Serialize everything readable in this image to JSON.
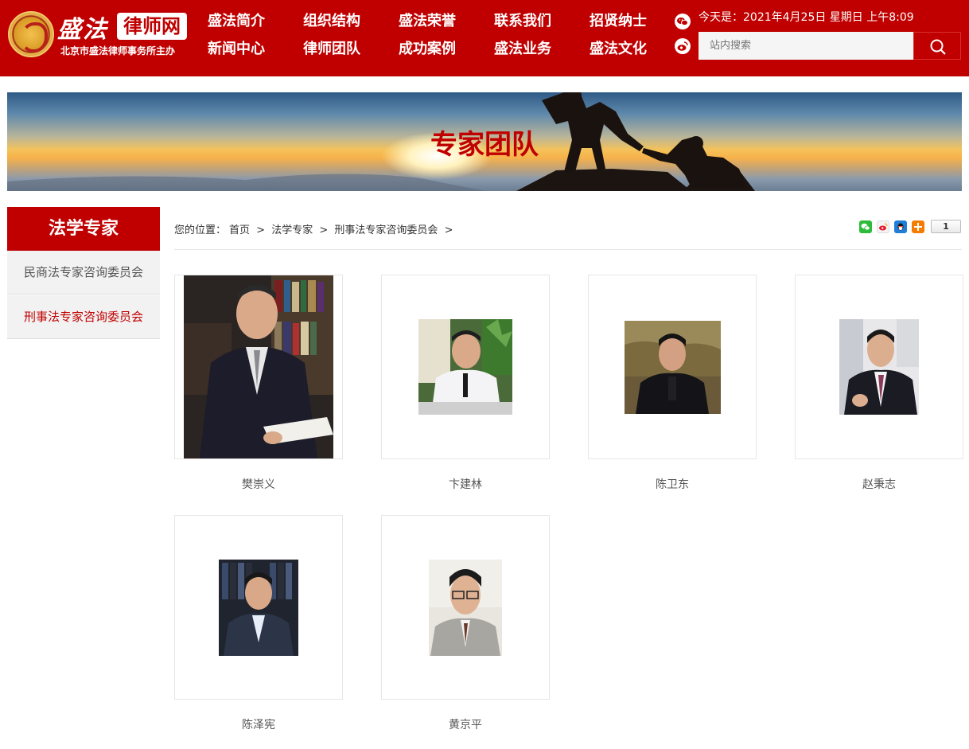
{
  "header": {
    "logo_script": "盛法",
    "logo_badge": "律师网",
    "logo_sub": "北京市盛法律师事务所主办",
    "nav_row1": [
      "盛法简介",
      "组织结构",
      "盛法荣誉",
      "联系我们",
      "招贤纳士"
    ],
    "nav_row2": [
      "新闻中心",
      "律师团队",
      "成功案例",
      "盛法业务",
      "盛法文化"
    ],
    "date_text": "今天是：2021年4月25日 星期日 上午8:09",
    "search_placeholder": "站内搜索",
    "icons": [
      "wechat-icon",
      "weibo-icon",
      "search-icon"
    ]
  },
  "banner": {
    "title": "专家团队"
  },
  "sidebar": {
    "title": "法学专家",
    "items": [
      {
        "label": "民商法专家咨询委员会",
        "active": false
      },
      {
        "label": "刑事法专家咨询委员会",
        "active": true
      }
    ]
  },
  "breadcrumb": {
    "prefix": "您的位置：",
    "items": [
      "首页",
      ">",
      "法学专家",
      ">",
      "刑事法专家咨询委员会",
      ">"
    ]
  },
  "share": {
    "count": "1",
    "icons": [
      "wechat-icon",
      "weibo-icon",
      "qq-icon",
      "more-icon"
    ]
  },
  "experts": [
    {
      "name": "樊崇义"
    },
    {
      "name": "卞建林"
    },
    {
      "name": "陈卫东"
    },
    {
      "name": "赵秉志"
    },
    {
      "name": "陈泽宪"
    },
    {
      "name": "黄京平"
    }
  ],
  "colors": {
    "brand_red": "#c00000",
    "sidebar_bg": "#f2f2f2",
    "border": "#e6e6e6"
  }
}
